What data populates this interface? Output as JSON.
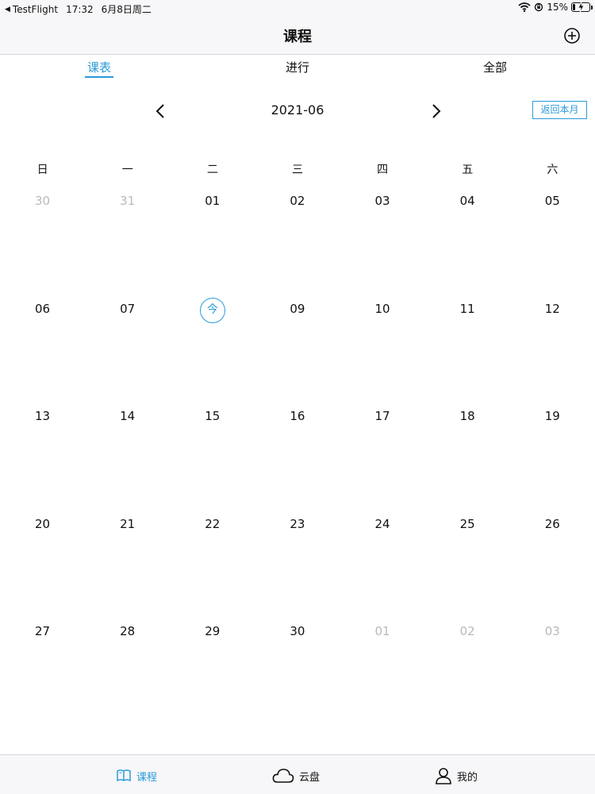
{
  "status_bar": {
    "back_app": "TestFlight",
    "time": "17:32",
    "date": "6月8日周二",
    "battery_percent": "15%",
    "battery_level": 0.15
  },
  "header": {
    "title": "课程",
    "add_icon": "plus-circle-icon"
  },
  "tabs": [
    {
      "label": "课表",
      "active": true
    },
    {
      "label": "进行",
      "active": false
    },
    {
      "label": "全部",
      "active": false
    }
  ],
  "month_nav": {
    "month": "2021-06",
    "back_to_month": "返回本月",
    "prev_icon": "chevron-left-icon",
    "next_icon": "chevron-right-icon"
  },
  "weekdays": [
    "日",
    "一",
    "二",
    "三",
    "四",
    "五",
    "六"
  ],
  "weeks": [
    [
      {
        "t": "30",
        "muted": true
      },
      {
        "t": "31",
        "muted": true
      },
      {
        "t": "01"
      },
      {
        "t": "02"
      },
      {
        "t": "03"
      },
      {
        "t": "04"
      },
      {
        "t": "05"
      }
    ],
    [
      {
        "t": "06"
      },
      {
        "t": "07"
      },
      {
        "t": "今",
        "today": true
      },
      {
        "t": "09"
      },
      {
        "t": "10"
      },
      {
        "t": "11"
      },
      {
        "t": "12"
      }
    ],
    [
      {
        "t": "13"
      },
      {
        "t": "14"
      },
      {
        "t": "15"
      },
      {
        "t": "16"
      },
      {
        "t": "17"
      },
      {
        "t": "18"
      },
      {
        "t": "19"
      }
    ],
    [
      {
        "t": "20"
      },
      {
        "t": "21"
      },
      {
        "t": "22"
      },
      {
        "t": "23"
      },
      {
        "t": "24"
      },
      {
        "t": "25"
      },
      {
        "t": "26"
      }
    ],
    [
      {
        "t": "27"
      },
      {
        "t": "28"
      },
      {
        "t": "29"
      },
      {
        "t": "30"
      },
      {
        "t": "01",
        "muted": true
      },
      {
        "t": "02",
        "muted": true
      },
      {
        "t": "03",
        "muted": true
      }
    ]
  ],
  "tabbar": [
    {
      "label": "课程",
      "icon": "book-icon",
      "active": true
    },
    {
      "label": "云盘",
      "icon": "cloud-icon",
      "active": false
    },
    {
      "label": "我的",
      "icon": "person-icon",
      "active": false
    }
  ],
  "colors": {
    "accent": "#2a9bd8",
    "muted": "#b9b9b9"
  }
}
